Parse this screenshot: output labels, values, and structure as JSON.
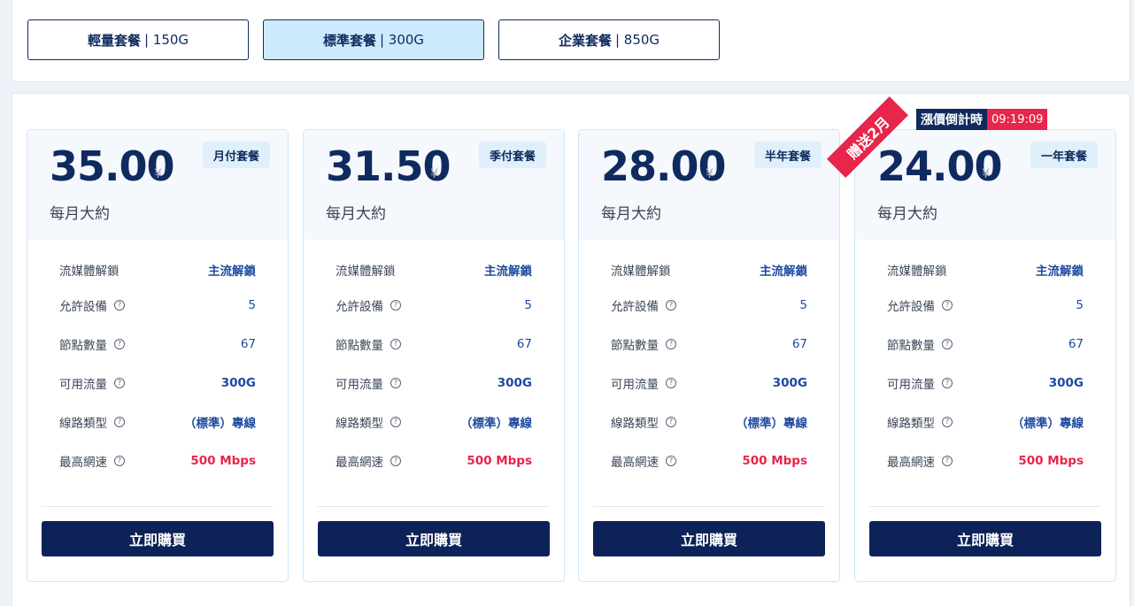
{
  "plan_tabs": [
    {
      "name": "輕量套餐",
      "size": "| 150G"
    },
    {
      "name": "標準套餐",
      "size": "| 300G"
    },
    {
      "name": "企業套餐",
      "size": "| 850G"
    }
  ],
  "promo": {
    "countdown_label": "漲價倒計時",
    "countdown_time": "09:19:09",
    "ribbon": "贈送2月"
  },
  "cards": [
    {
      "price": "35.00",
      "currency": "¥",
      "per_month": "每月大約",
      "period": "月付套餐",
      "features": [
        {
          "label": "流媒體解鎖",
          "value": "主流解鎖"
        },
        {
          "label": "允許設備",
          "value": "5"
        },
        {
          "label": "節點數量",
          "value": "67"
        },
        {
          "label": "可用流量",
          "value": "300G"
        },
        {
          "label": "線路類型",
          "value": "（標準）專線"
        },
        {
          "label": "最高網速",
          "value": "500 Mbps"
        }
      ],
      "buy": "立即購買"
    },
    {
      "price": "31.50",
      "currency": "¥",
      "per_month": "每月大約",
      "period": "季付套餐",
      "features": [
        {
          "label": "流媒體解鎖",
          "value": "主流解鎖"
        },
        {
          "label": "允許設備",
          "value": "5"
        },
        {
          "label": "節點數量",
          "value": "67"
        },
        {
          "label": "可用流量",
          "value": "300G"
        },
        {
          "label": "線路類型",
          "value": "（標準）專線"
        },
        {
          "label": "最高網速",
          "value": "500 Mbps"
        }
      ],
      "buy": "立即購買"
    },
    {
      "price": "28.00",
      "currency": "¥",
      "per_month": "每月大約",
      "period": "半年套餐",
      "features": [
        {
          "label": "流媒體解鎖",
          "value": "主流解鎖"
        },
        {
          "label": "允許設備",
          "value": "5"
        },
        {
          "label": "節點數量",
          "value": "67"
        },
        {
          "label": "可用流量",
          "value": "300G"
        },
        {
          "label": "線路類型",
          "value": "（標準）專線"
        },
        {
          "label": "最高網速",
          "value": "500 Mbps"
        }
      ],
      "buy": "立即購買"
    },
    {
      "price": "24.00",
      "currency": "¥",
      "per_month": "每月大約",
      "period": "一年套餐",
      "features": [
        {
          "label": "流媒體解鎖",
          "value": "主流解鎖"
        },
        {
          "label": "允許設備",
          "value": "5"
        },
        {
          "label": "節點數量",
          "value": "67"
        },
        {
          "label": "可用流量",
          "value": "300G"
        },
        {
          "label": "線路類型",
          "value": "（標準）專線"
        },
        {
          "label": "最高網速",
          "value": "500 Mbps"
        }
      ],
      "buy": "立即購買"
    }
  ],
  "colors": {
    "accent": "#0f2a5e",
    "highlight": "#e8254a",
    "active_tab": "#cdeafd"
  }
}
